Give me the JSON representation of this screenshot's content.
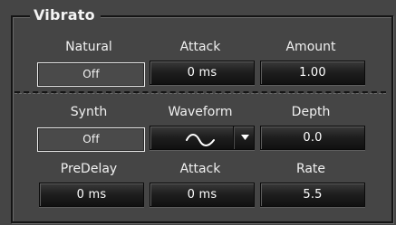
{
  "group": {
    "title": "Vibrato"
  },
  "row1": {
    "natural": {
      "label": "Natural",
      "value": "Off"
    },
    "attack": {
      "label": "Attack",
      "value": "0 ms"
    },
    "amount": {
      "label": "Amount",
      "value": "1.00"
    }
  },
  "row2": {
    "synth": {
      "label": "Synth",
      "value": "Off"
    },
    "waveform": {
      "label": "Waveform",
      "value_icon": "sine-wave-icon",
      "dropdown_icon": "chevron-down-icon"
    },
    "depth": {
      "label": "Depth",
      "value": "0.0"
    }
  },
  "row3": {
    "predelay": {
      "label": "PreDelay",
      "value": "0 ms"
    },
    "attack": {
      "label": "Attack",
      "value": "0 ms"
    },
    "rate": {
      "label": "Rate",
      "value": "5.5"
    }
  },
  "colors": {
    "background": "#454545",
    "text": "#f0f0f0",
    "button_dark": "#101010",
    "toggle_border": "#e8e8e8"
  }
}
